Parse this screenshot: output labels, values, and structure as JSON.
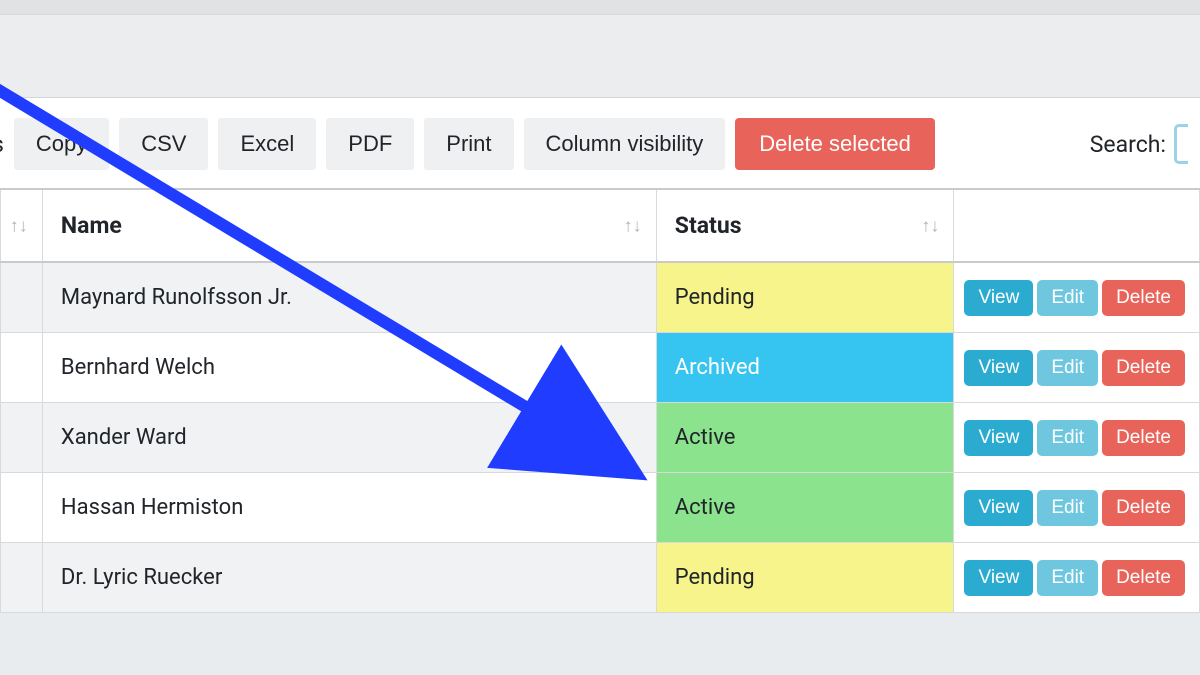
{
  "toolbar": {
    "entries_fragment": "s",
    "copy": "Copy",
    "csv": "CSV",
    "excel": "Excel",
    "pdf": "PDF",
    "print": "Print",
    "colvis": "Column visibility",
    "delete_selected": "Delete selected",
    "search_label": "Search:"
  },
  "columns": {
    "name": "Name",
    "status": "Status"
  },
  "actions": {
    "view": "View",
    "edit": "Edit",
    "delete": "Delete"
  },
  "rows": [
    {
      "name": "Maynard Runolfsson Jr.",
      "status": "Pending",
      "status_class": "status-pending"
    },
    {
      "name": "Bernhard Welch",
      "status": "Archived",
      "status_class": "status-archived"
    },
    {
      "name": "Xander Ward",
      "status": "Active",
      "status_class": "status-active"
    },
    {
      "name": "Hassan Hermiston",
      "status": "Active",
      "status_class": "status-active"
    },
    {
      "name": "Dr. Lyric Ruecker",
      "status": "Pending",
      "status_class": "status-pending"
    }
  ],
  "colors": {
    "btn_view": "#2cabd1",
    "btn_edit": "#6ec7df",
    "btn_delete": "#e8635a",
    "status_pending": "#f6f48b",
    "status_archived": "#36c4f0",
    "status_active": "#8be38e",
    "arrow": "#1f3cff"
  }
}
